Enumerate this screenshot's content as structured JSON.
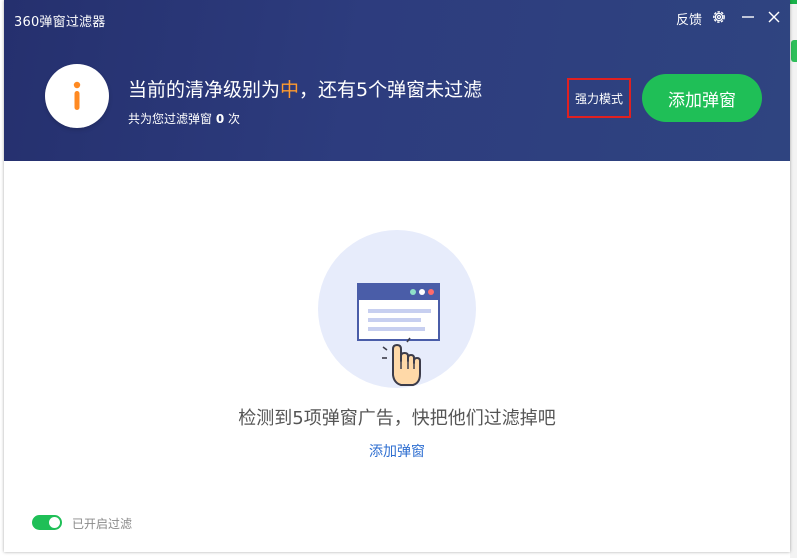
{
  "window": {
    "title": "360弹窗过滤器",
    "feedback_label": "反馈",
    "icons": [
      "settings-icon",
      "minimize-icon",
      "close-icon"
    ]
  },
  "header": {
    "headline_prefix": "当前的清净级别为",
    "level": "中",
    "headline_suffix": "，还有5个弹窗未过滤",
    "sub_prefix": "共为您过滤弹窗",
    "filtered_count": "0",
    "sub_suffix": "次",
    "mode_button": "强力模式",
    "add_button": "添加弹窗"
  },
  "main": {
    "message": "检测到5项弹窗广告，快把他们过滤掉吧",
    "link": "添加弹窗"
  },
  "footer": {
    "toggle_label": "已开启过滤",
    "toggle_on": true
  },
  "colors": {
    "header_bg": "#2d3c7e",
    "accent_green": "#1fbf57",
    "level_orange": "#ff9a2e",
    "link_blue": "#2f6fd1",
    "highlight_red": "#e02020"
  }
}
